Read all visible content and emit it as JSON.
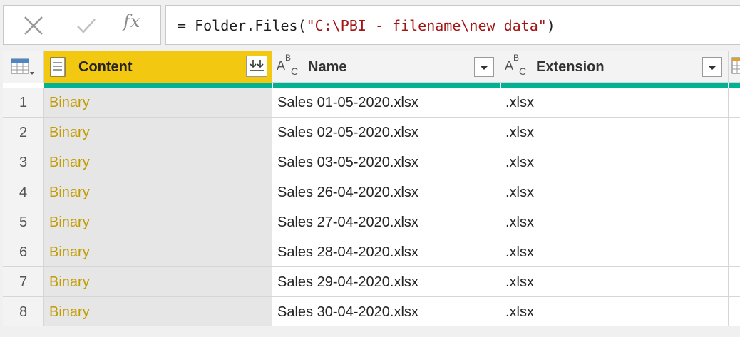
{
  "formula_bar": {
    "fx_label": "fx",
    "prefix": "= Folder.Files(",
    "string_arg": "\"C:\\PBI - filename\\new data\"",
    "suffix": ")"
  },
  "columns": [
    {
      "name": "Content",
      "type_icon": "document-icon",
      "selected": true
    },
    {
      "name": "Name",
      "type_icon": "text-type-icon"
    },
    {
      "name": "Extension",
      "type_icon": "text-type-icon"
    }
  ],
  "type_glyph": {
    "a": "A",
    "b": "B",
    "c": "C"
  },
  "rows": [
    {
      "index": "1",
      "content": "Binary",
      "name": "Sales 01-05-2020.xlsx",
      "extension": ".xlsx"
    },
    {
      "index": "2",
      "content": "Binary",
      "name": "Sales 02-05-2020.xlsx",
      "extension": ".xlsx"
    },
    {
      "index": "3",
      "content": "Binary",
      "name": "Sales 03-05-2020.xlsx",
      "extension": ".xlsx"
    },
    {
      "index": "4",
      "content": "Binary",
      "name": "Sales 26-04-2020.xlsx",
      "extension": ".xlsx"
    },
    {
      "index": "5",
      "content": "Binary",
      "name": "Sales 27-04-2020.xlsx",
      "extension": ".xlsx"
    },
    {
      "index": "6",
      "content": "Binary",
      "name": "Sales 28-04-2020.xlsx",
      "extension": ".xlsx"
    },
    {
      "index": "7",
      "content": "Binary",
      "name": "Sales 29-04-2020.xlsx",
      "extension": ".xlsx"
    },
    {
      "index": "8",
      "content": "Binary",
      "name": "Sales 30-04-2020.xlsx",
      "extension": ".xlsx"
    }
  ],
  "colors": {
    "selected_header": "#f2c811",
    "quality_bar": "#00b294",
    "binary_text": "#c19c00",
    "string_literal": "#a31515"
  }
}
